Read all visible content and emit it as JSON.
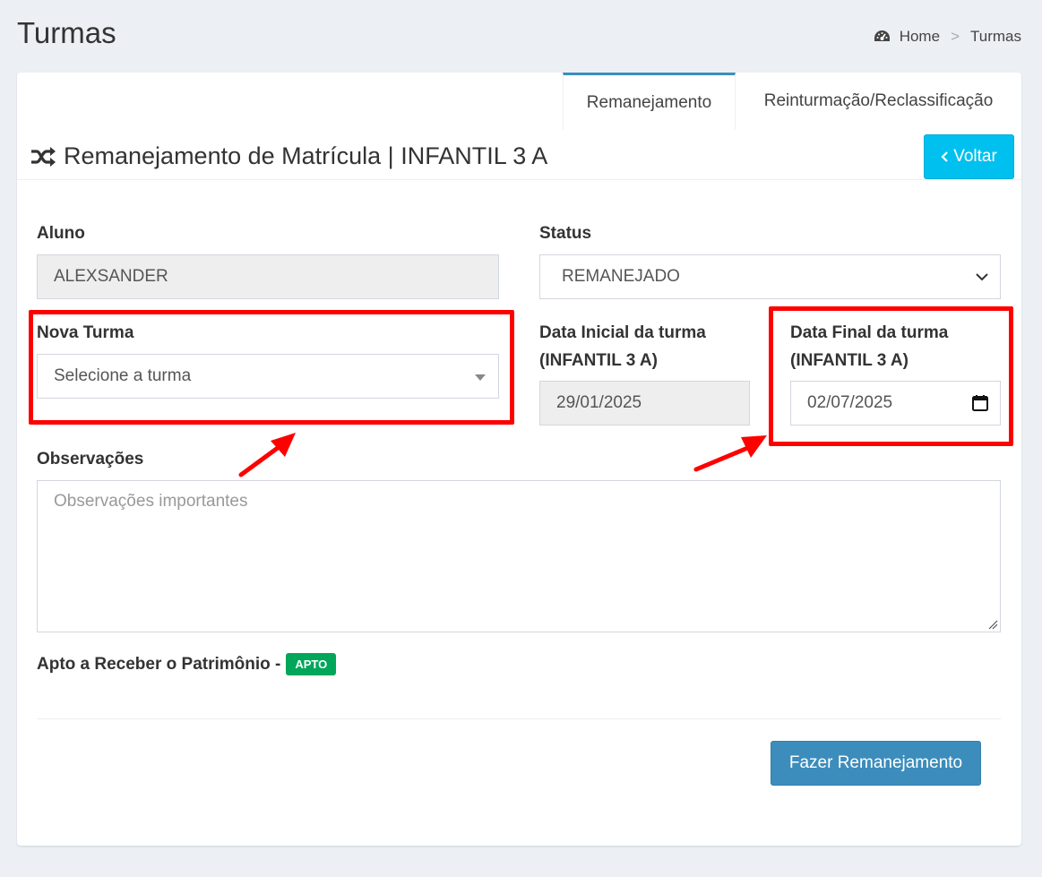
{
  "page": {
    "title": "Turmas"
  },
  "breadcrumb": {
    "home": "Home",
    "separator": ">",
    "current": "Turmas"
  },
  "tabs": [
    {
      "label": "Remanejamento",
      "active": true
    },
    {
      "label": "Reinturmação/Reclassificação",
      "active": false
    }
  ],
  "header": {
    "title": "Remanejamento de Matrícula | INFANTIL 3 A",
    "back_label": "Voltar"
  },
  "form": {
    "aluno": {
      "label": "Aluno",
      "value": "ALEXSANDER"
    },
    "status": {
      "label": "Status",
      "value": "REMANEJADO"
    },
    "nova_turma": {
      "label": "Nova Turma",
      "value": "Selecione a turma"
    },
    "data_inicial": {
      "label_line1": "Data Inicial da turma",
      "label_line2": "(INFANTIL 3 A)",
      "value": "29/01/2025"
    },
    "data_final": {
      "label_line1": "Data Final da turma",
      "label_line2": "(INFANTIL 3 A)",
      "value": "02/07/2025"
    },
    "observacoes": {
      "label": "Observações",
      "placeholder": "Observações importantes"
    },
    "apto": {
      "label": "Apto a Receber o Patrimônio -",
      "badge": "APTO"
    },
    "submit_label": "Fazer Remanejamento"
  },
  "colors": {
    "accent": "#3c8dbc",
    "info": "#00c0ef",
    "success": "#00a65a",
    "highlight": "#ff0000"
  }
}
